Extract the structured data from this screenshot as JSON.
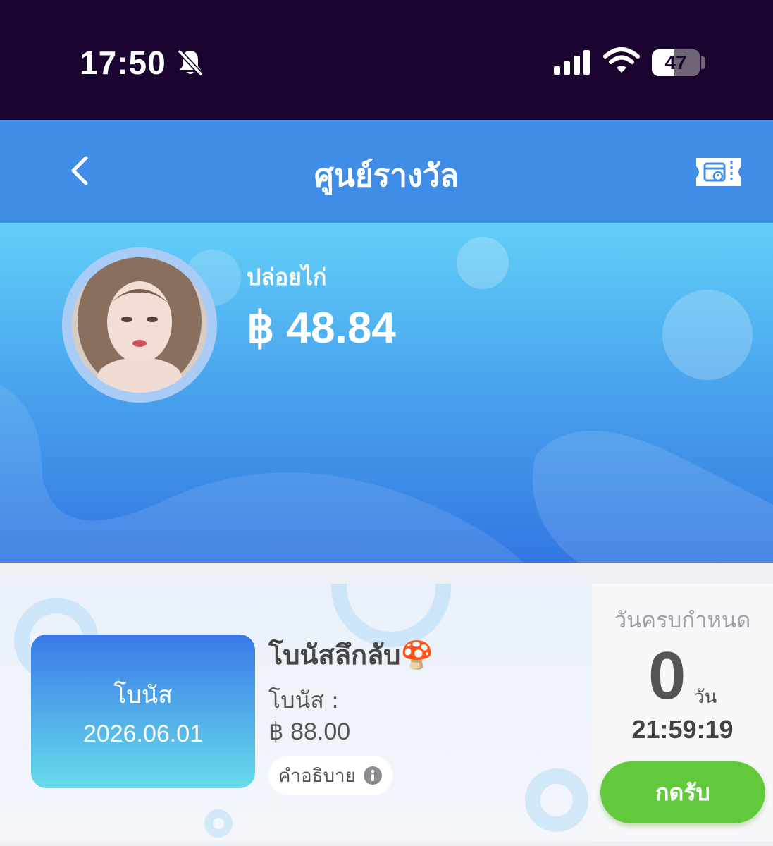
{
  "status_bar": {
    "time": "17:50",
    "battery": "47",
    "icons": [
      "bell-slash-icon",
      "signal-icon",
      "wifi-icon",
      "battery-icon"
    ]
  },
  "nav": {
    "title": "ศูนย์รางวัล",
    "back_icon": "chevron-left-icon",
    "right_icon": "ticket-calendar-icon"
  },
  "profile": {
    "username": "ปล่อยไก่",
    "balance": "฿ 48.84"
  },
  "bonus_card": {
    "tile_label": "โบนัส",
    "tile_date": "2026.06.01",
    "name": "โบนัสลึกลับ🍄",
    "amount_label": "โบนัส :",
    "amount": "฿ 88.00",
    "description_label": "คำอธิบาย",
    "due_label": "วันครบกำหนด",
    "due_days": "0",
    "due_days_unit": "วัน",
    "due_time": "21:59:19",
    "claim_label": "กดรับ"
  },
  "colors": {
    "status_bar_bg": "#1b0530",
    "nav_bg": "#3f8de6",
    "claim_button": "#62c93c",
    "tile_gradient_top": "#3a79e8",
    "tile_gradient_bottom": "#67dcea"
  }
}
